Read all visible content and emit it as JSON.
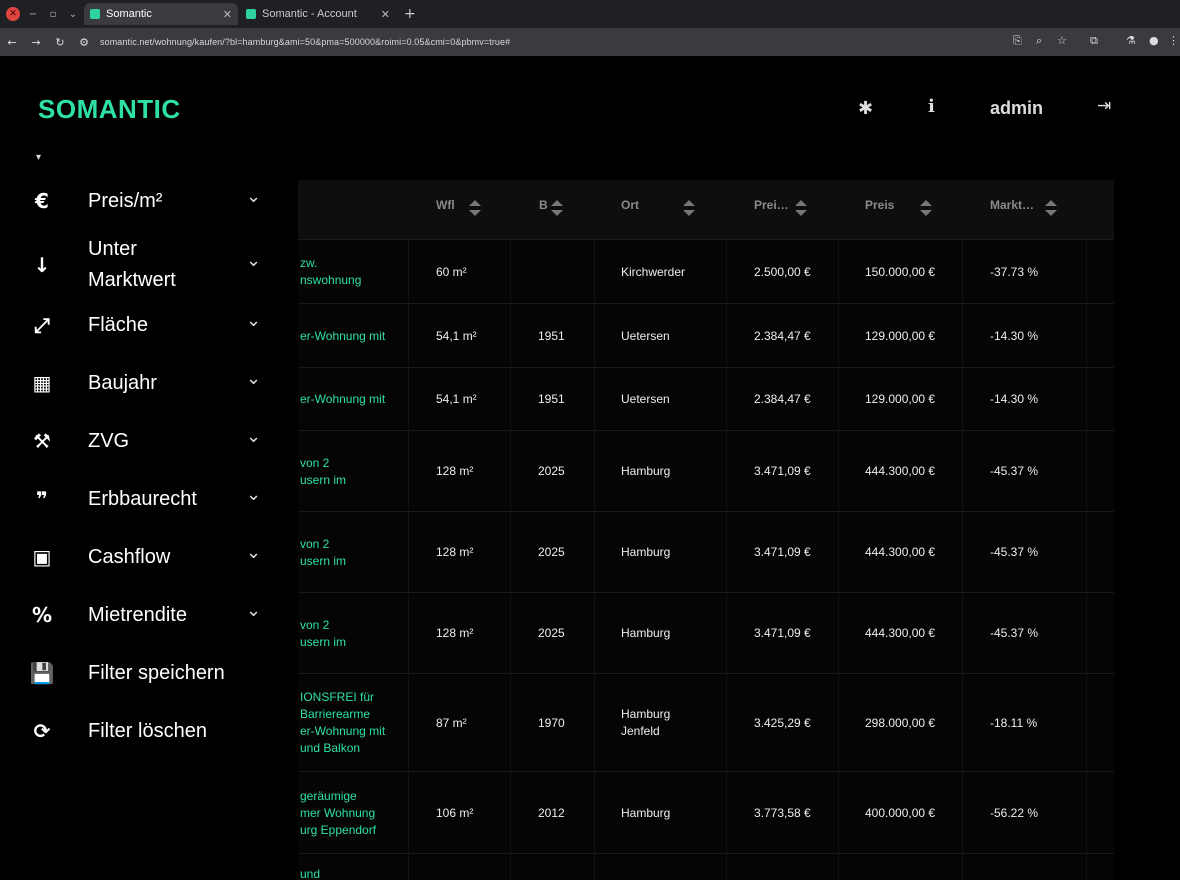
{
  "browser": {
    "tabs": [
      {
        "label": "Somantic"
      },
      {
        "label": "Somantic - Account"
      }
    ],
    "url": "somantic.net/wohnung/kaufen/?bl=hamburg&ami=50&pma=500000&roimi=0.05&cmi=0&pbmv=true#"
  },
  "header": {
    "logo": "SOMANTIC",
    "user": "admin"
  },
  "sidebar": {
    "items": [
      {
        "icon": "€",
        "label": "Preis/m²",
        "has_dropdown": true
      },
      {
        "icon": "↓",
        "label": "Unter\nMarktwert",
        "has_dropdown": true
      },
      {
        "icon": "⤢",
        "label": "Fläche",
        "has_dropdown": true
      },
      {
        "icon": "▦",
        "label": "Baujahr",
        "has_dropdown": true
      },
      {
        "icon": "⚒",
        "label": "ZVG",
        "has_dropdown": true
      },
      {
        "icon": "❞",
        "label": "Erbbaurecht",
        "has_dropdown": true
      },
      {
        "icon": "▣",
        "label": "Cashflow",
        "has_dropdown": true
      },
      {
        "icon": "%",
        "label": "Mietrendite",
        "has_dropdown": true
      },
      {
        "icon": "💾",
        "label": "Filter speichern",
        "has_dropdown": false
      },
      {
        "icon": "⟳",
        "label": "Filter löschen",
        "has_dropdown": false
      }
    ]
  },
  "table": {
    "columns": [
      "Wfl",
      "B",
      "Ort",
      "Prei…",
      "Preis",
      "Markt…"
    ],
    "rows": [
      {
        "title": "zw.\nnswohnung",
        "wfl": "60 m²",
        "baujahr": "",
        "ort": "Kirchwerder",
        "preis_m2": "2.500,00 €",
        "preis": "150.000,00 €",
        "markt": "-37.73 %"
      },
      {
        "title": "er-Wohnung mit",
        "wfl": "54,1 m²",
        "baujahr": "1951",
        "ort": "Uetersen",
        "preis_m2": "2.384,47 €",
        "preis": "129.000,00 €",
        "markt": "-14.30 %"
      },
      {
        "title": "er-Wohnung mit",
        "wfl": "54,1 m²",
        "baujahr": "1951",
        "ort": "Uetersen",
        "preis_m2": "2.384,47 €",
        "preis": "129.000,00 €",
        "markt": "-14.30 %"
      },
      {
        "title": "von 2\nusern im",
        "wfl": "128 m²",
        "baujahr": "2025",
        "ort": "Hamburg",
        "preis_m2": "3.471,09 €",
        "preis": "444.300,00 €",
        "markt": "-45.37 %"
      },
      {
        "title": "von 2\nusern im",
        "wfl": "128 m²",
        "baujahr": "2025",
        "ort": "Hamburg",
        "preis_m2": "3.471,09 €",
        "preis": "444.300,00 €",
        "markt": "-45.37 %"
      },
      {
        "title": "von 2\nusern im",
        "wfl": "128 m²",
        "baujahr": "2025",
        "ort": "Hamburg",
        "preis_m2": "3.471,09 €",
        "preis": "444.300,00 €",
        "markt": "-45.37 %"
      },
      {
        "title": "IONSFREI für\nBarrierearme\ner-Wohnung mit\nund Balkon",
        "wfl": "87 m²",
        "baujahr": "1970",
        "ort": "Hamburg\nJenfeld",
        "preis_m2": "3.425,29 €",
        "preis": "298.000,00 €",
        "markt": "-18.11 %"
      },
      {
        "title": "geräumige\nmer Wohnung\nurg Eppendorf",
        "wfl": "106 m²",
        "baujahr": "2012",
        "ort": "Hamburg",
        "preis_m2": "3.773,58 €",
        "preis": "400.000,00 €",
        "markt": "-56.22 %"
      },
      {
        "title": "und",
        "wfl": "",
        "baujahr": "",
        "ort": "",
        "preis_m2": "",
        "preis": "",
        "markt": ""
      }
    ]
  }
}
